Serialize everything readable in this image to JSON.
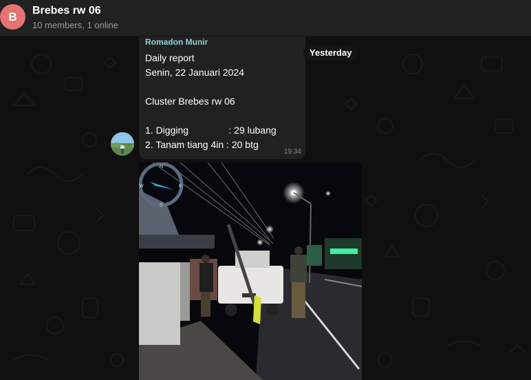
{
  "header": {
    "avatar_letter": "B",
    "avatar_color": "#e57373",
    "title": "Brebes rw 06",
    "subtitle": "10 members, 1 online"
  },
  "chat": {
    "date_pill": "Yesterday",
    "message": {
      "sender": "Romadon Munir",
      "sender_color": "#8fd0d9",
      "lines": [
        "Daily report",
        "Senin, 22 Januari 2024",
        "",
        "Cluster Brebes rw 06",
        "",
        "1. Digging               : 29 lubang",
        "2. Tanam tiang 4in : 20 btg"
      ],
      "time": "19:34"
    },
    "photo": {
      "compass_labels": [
        "N",
        "E",
        "S",
        "W"
      ]
    }
  }
}
